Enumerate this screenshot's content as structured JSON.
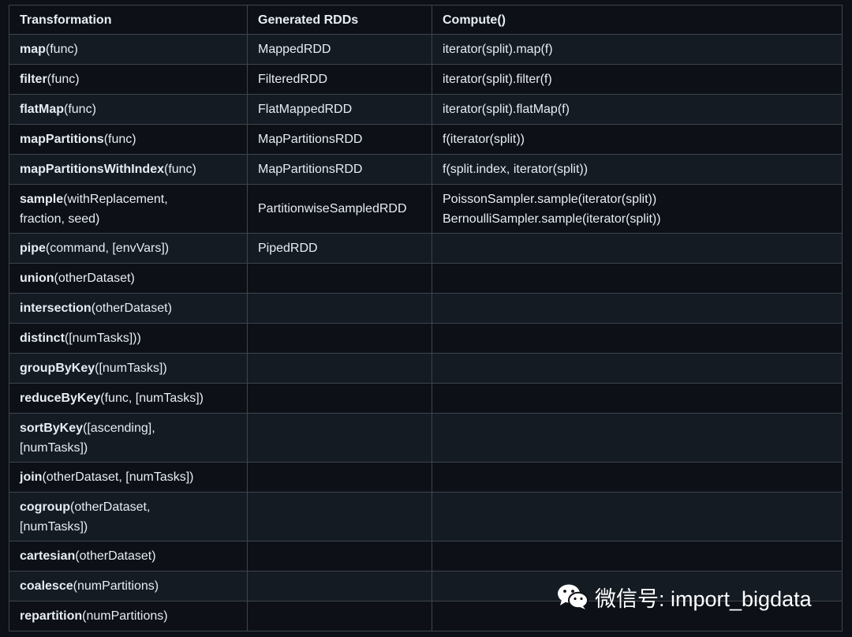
{
  "table": {
    "headers": [
      "Transformation",
      "Generated RDDs",
      "Compute()"
    ],
    "rows": [
      {
        "name": "map",
        "args": "(func)",
        "rdd": "MappedRDD",
        "compute": [
          "iterator(split).map(f)"
        ]
      },
      {
        "name": "filter",
        "args": "(func)",
        "rdd": "FilteredRDD",
        "compute": [
          "iterator(split).filter(f)"
        ]
      },
      {
        "name": "flatMap",
        "args": "(func)",
        "rdd": "FlatMappedRDD",
        "compute": [
          "iterator(split).flatMap(f)"
        ]
      },
      {
        "name": "mapPartitions",
        "args": "(func)",
        "rdd": "MapPartitionsRDD",
        "compute": [
          "f(iterator(split))"
        ]
      },
      {
        "name": "mapPartitionsWithIndex",
        "args": "(func)",
        "rdd": "MapPartitionsRDD",
        "compute": [
          "f(split.index, iterator(split))"
        ]
      },
      {
        "name": "sample",
        "args": "(withReplacement,",
        "args2": "fraction, seed)",
        "rdd": "PartitionwiseSampledRDD",
        "compute": [
          "PoissonSampler.sample(iterator(split))",
          "BernoulliSampler.sample(iterator(split))"
        ]
      },
      {
        "name": "pipe",
        "args": "(command, [envVars])",
        "rdd": "PipedRDD",
        "compute": []
      },
      {
        "name": "union",
        "args": "(otherDataset)",
        "rdd": "",
        "compute": []
      },
      {
        "name": "intersection",
        "args": "(otherDataset)",
        "rdd": "",
        "compute": []
      },
      {
        "name": "distinct",
        "args": "([numTasks]))",
        "rdd": "",
        "compute": []
      },
      {
        "name": "groupByKey",
        "args": "([numTasks])",
        "rdd": "",
        "compute": []
      },
      {
        "name": "reduceByKey",
        "args": "(func, [numTasks])",
        "rdd": "",
        "compute": []
      },
      {
        "name": "sortByKey",
        "args": "([ascending],",
        "args2": "[numTasks])",
        "rdd": "",
        "compute": []
      },
      {
        "name": "join",
        "args": "(otherDataset, [numTasks])",
        "rdd": "",
        "compute": []
      },
      {
        "name": "cogroup",
        "args": "(otherDataset,",
        "args2": "[numTasks])",
        "rdd": "",
        "compute": []
      },
      {
        "name": "cartesian",
        "args": "(otherDataset)",
        "rdd": "",
        "compute": []
      },
      {
        "name": "coalesce",
        "args": "(numPartitions)",
        "rdd": "",
        "compute": []
      },
      {
        "name": "repartition",
        "args": "(numPartitions)",
        "rdd": "",
        "compute": []
      }
    ]
  },
  "watermark": {
    "icon": "wechat-icon",
    "text": "微信号: import_bigdata"
  }
}
